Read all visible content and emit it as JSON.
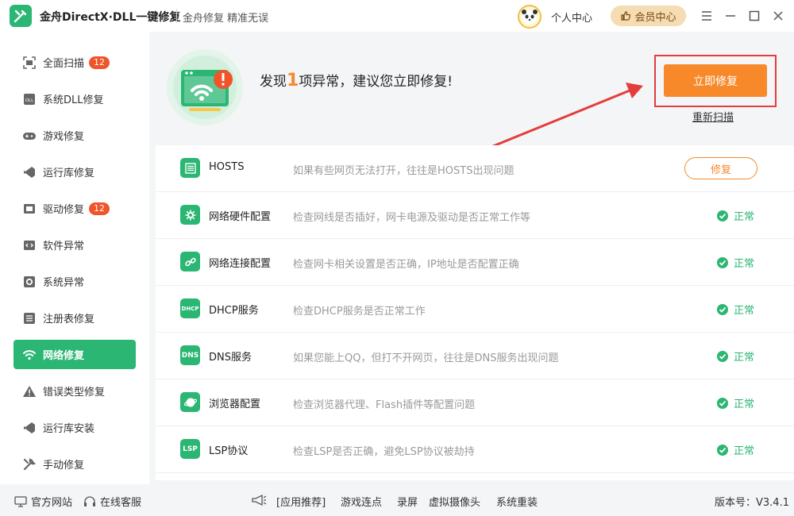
{
  "app": {
    "title": "金舟DirectX·DLL一键修复",
    "slogan": "金舟修复 精准无误",
    "personal_center": "个人中心",
    "vip_center": "会员中心",
    "brand_color": "#2bb673",
    "accent_color": "#f7892b"
  },
  "sidebar": {
    "items": [
      {
        "label": "全面扫描",
        "icon": "scan-icon",
        "badge": "12"
      },
      {
        "label": "系统DLL修复",
        "icon": "dll-icon",
        "badge": ""
      },
      {
        "label": "游戏修复",
        "icon": "gamepad-icon",
        "badge": ""
      },
      {
        "label": "运行库修复",
        "icon": "runtime-icon",
        "badge": ""
      },
      {
        "label": "驱动修复",
        "icon": "driver-icon",
        "badge": "12"
      },
      {
        "label": "软件异常",
        "icon": "code-window-icon",
        "badge": ""
      },
      {
        "label": "系统异常",
        "icon": "gear-box-icon",
        "badge": ""
      },
      {
        "label": "注册表修复",
        "icon": "registry-list-icon",
        "badge": ""
      },
      {
        "label": "网络修复",
        "icon": "wifi-icon",
        "badge": "",
        "active": true
      },
      {
        "label": "错误类型修复",
        "icon": "warning-icon",
        "badge": ""
      },
      {
        "label": "运行库安装",
        "icon": "runtime-install-icon",
        "badge": ""
      },
      {
        "label": "手动修复",
        "icon": "wrench-icon",
        "badge": ""
      }
    ]
  },
  "main": {
    "headline_prefix": "发现",
    "headline_count": "1",
    "headline_suffix": "项异常，建议您立即修复!",
    "fix_now": "立即修复",
    "rescan": "重新扫描",
    "fix_label": "修复",
    "normal_label": "正常",
    "rows": [
      {
        "name": "HOSTS",
        "icon_text": "",
        "desc": "如果有些网页无法打开，往往是HOSTS出现问题",
        "status": "fix"
      },
      {
        "name": "网络硬件配置",
        "icon_text": "",
        "desc": "检查网线是否插好，网卡电源及驱动是否正常工作等",
        "status": "normal"
      },
      {
        "name": "网络连接配置",
        "icon_text": "",
        "desc": "检查网卡相关设置是否正确，IP地址是否配置正确",
        "status": "normal"
      },
      {
        "name": "DHCP服务",
        "icon_text": "DHCP",
        "desc": "检查DHCP服务是否正常工作",
        "status": "normal"
      },
      {
        "name": "DNS服务",
        "icon_text": "DNS",
        "desc": "如果您能上QQ，但打不开网页，往往是DNS服务出现问题",
        "status": "normal"
      },
      {
        "name": "浏览器配置",
        "icon_text": "",
        "desc": "检查浏览器代理、Flash插件等配置问题",
        "status": "normal"
      },
      {
        "name": "LSP协议",
        "icon_text": "LSP",
        "desc": "检查LSP是否正确，避免LSP协议被劫持",
        "status": "normal"
      }
    ]
  },
  "footer": {
    "official_site": "官方网站",
    "online_service": "在线客服",
    "recommend": "[应用推荐]",
    "links": [
      "游戏连点",
      "录屏",
      "虚拟摄像头",
      "系统重装"
    ],
    "version": "版本号：V3.4.1"
  }
}
